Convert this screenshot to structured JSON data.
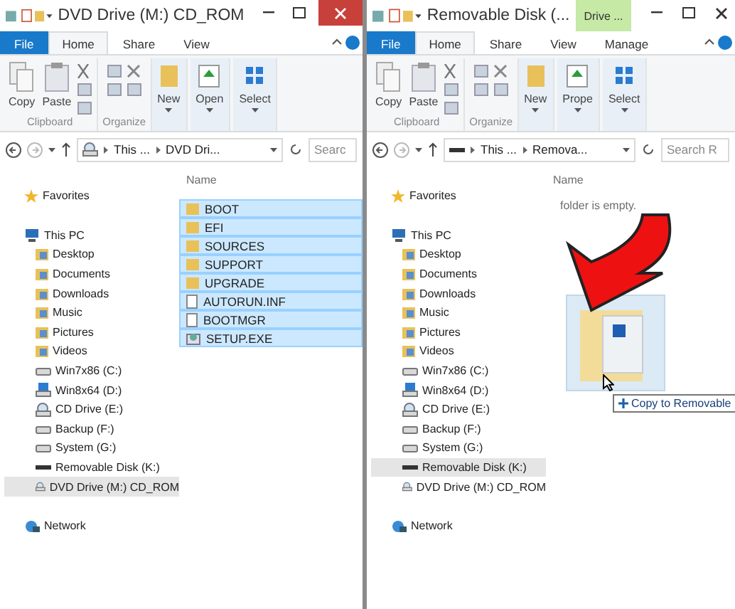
{
  "windows": [
    {
      "title": "DVD Drive (M:) CD_ROM",
      "active_close": true,
      "tabs": [
        {
          "label": "File",
          "selected": false,
          "kind": "file"
        },
        {
          "label": "Home",
          "selected": true,
          "kind": "tab"
        },
        {
          "label": "Share",
          "selected": false,
          "kind": "tab"
        },
        {
          "label": "View",
          "selected": false,
          "kind": "tab"
        }
      ],
      "groups": [
        {
          "label": "Clipboard",
          "kind": "clipboard",
          "buttons": [
            "Copy",
            "Paste"
          ]
        },
        {
          "label": "Organize",
          "kind": "organize"
        },
        {
          "kind": "new",
          "buttons": [
            "New"
          ]
        },
        {
          "kind": "open",
          "buttons": [
            "Open"
          ]
        },
        {
          "kind": "select",
          "buttons": [
            "Select"
          ]
        }
      ],
      "breadcrumbs": [
        "This ...",
        "DVD Dri..."
      ],
      "search": {
        "placeholder": "Searc"
      },
      "nav": {
        "favorites": "Favorites",
        "this_pc": "This PC",
        "network": "Network",
        "items": [
          {
            "label": "Desktop",
            "kind": "folder",
            "selected": false
          },
          {
            "label": "Documents",
            "kind": "folder",
            "selected": false
          },
          {
            "label": "Downloads",
            "kind": "folder",
            "selected": false
          },
          {
            "label": "Music",
            "kind": "folder",
            "selected": false
          },
          {
            "label": "Pictures",
            "kind": "folder",
            "selected": false
          },
          {
            "label": "Videos",
            "kind": "folder",
            "selected": false
          },
          {
            "label": "Win7x86 (C:)",
            "kind": "drive",
            "selected": false
          },
          {
            "label": "Win8x64 (D:)",
            "kind": "windrive",
            "selected": false
          },
          {
            "label": "CD Drive (E:)",
            "kind": "cd",
            "selected": false
          },
          {
            "label": "Backup (F:)",
            "kind": "drive",
            "selected": false
          },
          {
            "label": "System (G:)",
            "kind": "drive",
            "selected": false
          },
          {
            "label": "Removable Disk (K:)",
            "kind": "removable",
            "selected": false
          },
          {
            "label": "DVD Drive (M:) CD_ROM",
            "kind": "cd",
            "selected": true
          }
        ]
      },
      "column": "Name",
      "files": [
        {
          "name": "BOOT",
          "kind": "folder",
          "selected": true
        },
        {
          "name": "EFI",
          "kind": "folder",
          "selected": true
        },
        {
          "name": "SOURCES",
          "kind": "folder",
          "selected": true
        },
        {
          "name": "SUPPORT",
          "kind": "folder",
          "selected": true
        },
        {
          "name": "UPGRADE",
          "kind": "folder",
          "selected": true
        },
        {
          "name": "AUTORUN.INF",
          "kind": "file",
          "selected": true
        },
        {
          "name": "BOOTMGR",
          "kind": "file",
          "selected": true
        },
        {
          "name": "SETUP.EXE",
          "kind": "setup",
          "selected": true
        }
      ]
    },
    {
      "title": "Removable Disk (...",
      "context_tab": "Drive ...",
      "active_close": false,
      "tabs": [
        {
          "label": "File",
          "selected": false,
          "kind": "file"
        },
        {
          "label": "Home",
          "selected": true,
          "kind": "tab"
        },
        {
          "label": "Share",
          "selected": false,
          "kind": "tab"
        },
        {
          "label": "View",
          "selected": false,
          "kind": "tab"
        },
        {
          "label": "Manage",
          "selected": false,
          "kind": "tab"
        }
      ],
      "groups": [
        {
          "label": "Clipboard",
          "kind": "clipboard",
          "buttons": [
            "Copy",
            "Paste"
          ]
        },
        {
          "label": "Organize",
          "kind": "organize"
        },
        {
          "kind": "new",
          "buttons": [
            "New"
          ]
        },
        {
          "kind": "open",
          "buttons": [
            "Prope"
          ]
        },
        {
          "kind": "select",
          "buttons": [
            "Select"
          ]
        }
      ],
      "breadcrumbs": [
        "This ...",
        "Remova..."
      ],
      "search": {
        "placeholder": "Search R"
      },
      "nav": {
        "favorites": "Favorites",
        "this_pc": "This PC",
        "network": "Network",
        "items": [
          {
            "label": "Desktop",
            "kind": "folder",
            "selected": false
          },
          {
            "label": "Documents",
            "kind": "folder",
            "selected": false
          },
          {
            "label": "Downloads",
            "kind": "folder",
            "selected": false
          },
          {
            "label": "Music",
            "kind": "folder",
            "selected": false
          },
          {
            "label": "Pictures",
            "kind": "folder",
            "selected": false
          },
          {
            "label": "Videos",
            "kind": "folder",
            "selected": false
          },
          {
            "label": "Win7x86 (C:)",
            "kind": "drive",
            "selected": false
          },
          {
            "label": "Win8x64 (D:)",
            "kind": "windrive",
            "selected": false
          },
          {
            "label": "CD Drive (E:)",
            "kind": "cd",
            "selected": false
          },
          {
            "label": "Backup (F:)",
            "kind": "drive",
            "selected": false
          },
          {
            "label": "System (G:)",
            "kind": "drive",
            "selected": false
          },
          {
            "label": "Removable Disk (K:)",
            "kind": "removable",
            "selected": true
          },
          {
            "label": "DVD Drive (M:) CD_ROM",
            "kind": "cd",
            "selected": false
          }
        ]
      },
      "column": "Name",
      "empty_text": "folder is empty.",
      "drag_tooltip": "Copy to Removable"
    }
  ]
}
